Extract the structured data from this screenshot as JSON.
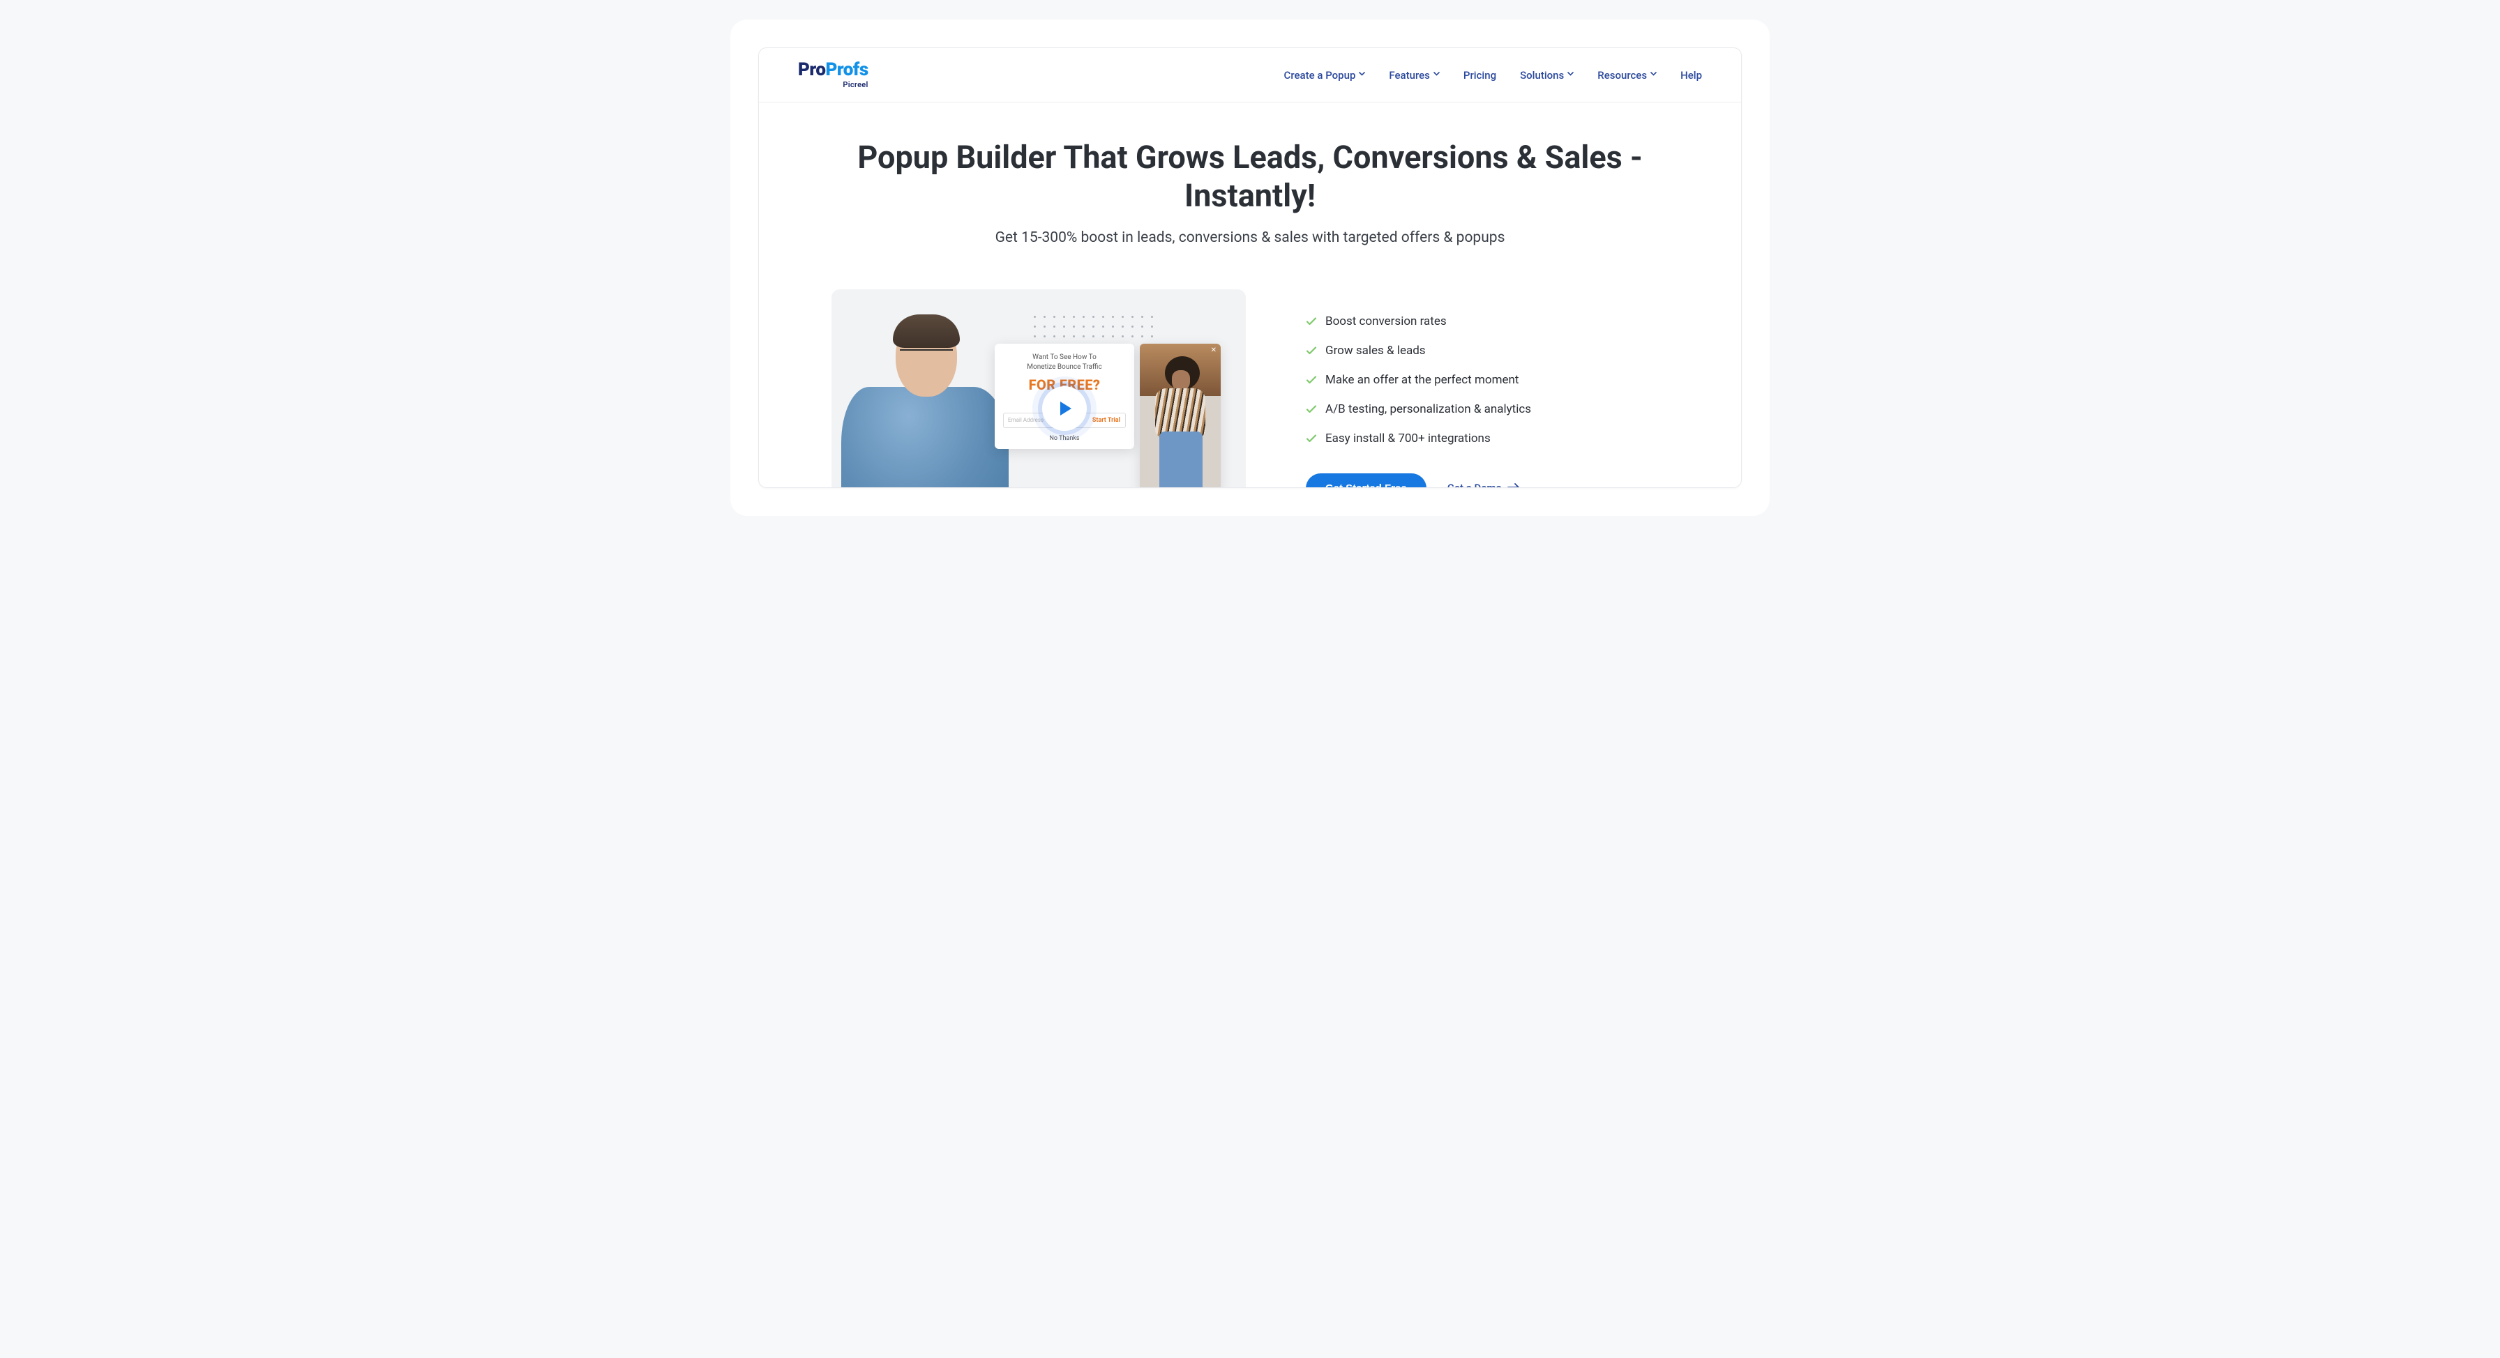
{
  "logo": {
    "part1": "Pro",
    "part2": "Profs",
    "sub": "Picreel"
  },
  "nav": {
    "create": "Create a Popup",
    "features": "Features",
    "pricing": "Pricing",
    "solutions": "Solutions",
    "resources": "Resources",
    "help": "Help"
  },
  "hero": {
    "title": "Popup Builder That Grows Leads, Conversions & Sales - Instantly!",
    "subtitle": "Get 15-300% boost in leads, conversions & sales with targeted offers & popups"
  },
  "popup_card": {
    "line1": "Want To See How To",
    "line2": "Monetize Bounce Traffic",
    "highlight": "FOR FREE?",
    "placeholder": "Email Address",
    "trial": "Start Trial",
    "nothanks": "No Thanks"
  },
  "features": [
    "Boost conversion rates",
    "Grow sales & leads",
    "Make an offer at the perfect moment",
    "A/B testing, personalization & analytics",
    "Easy install & 700+ integrations"
  ],
  "cta": {
    "primary": "Get Started Free",
    "demo": "Get a Demo"
  }
}
